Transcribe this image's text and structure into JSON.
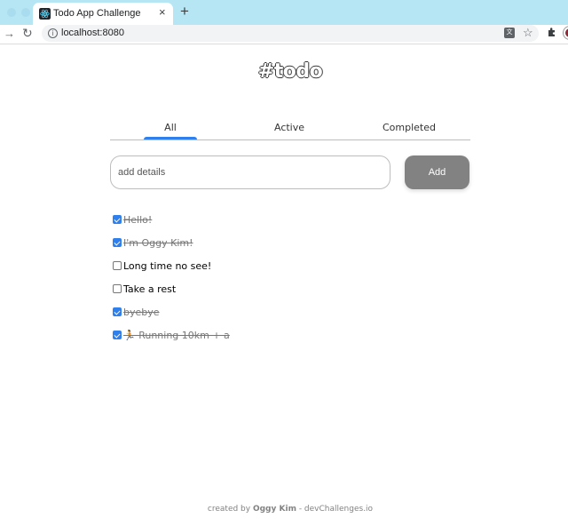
{
  "browser": {
    "tab_title": "Todo App Challenge",
    "tab_close": "×",
    "new_tab": "+",
    "url": "localhost:8080",
    "icons": {
      "favicon": "react-logo-icon",
      "back": "arrow-left-icon",
      "reload": "reload-icon",
      "info": "info-icon",
      "translate": "translate-icon",
      "bookmark": "star-icon",
      "extensions": "puzzle-icon",
      "profile": "avatar"
    }
  },
  "app": {
    "title": "#todo",
    "tabs": [
      {
        "label": "All",
        "selected": true
      },
      {
        "label": "Active",
        "selected": false
      },
      {
        "label": "Completed",
        "selected": false
      }
    ],
    "input": {
      "placeholder": "add details",
      "value": ""
    },
    "add_button": "Add",
    "accent_color": "#2f80ed",
    "todos": [
      {
        "text": "Hello!",
        "done": true
      },
      {
        "text": "I'm Oggy Kim!",
        "done": true
      },
      {
        "text": "Long time no see!",
        "done": false
      },
      {
        "text": "Take a rest",
        "done": false
      },
      {
        "text": "byebye",
        "done": true
      },
      {
        "text": "🏃 Running 10km + a",
        "done": true
      }
    ]
  },
  "footer": {
    "prefix": "created by",
    "author": "Oggy Kim",
    "suffix": "- devChallenges.io"
  }
}
